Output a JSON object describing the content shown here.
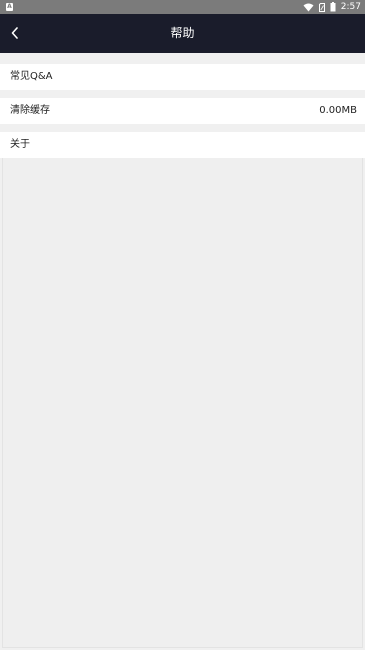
{
  "status_bar": {
    "time": "2:57",
    "left_icon_label": "A",
    "icons": [
      "notification-a-icon",
      "wifi-icon",
      "sim-card-icon",
      "battery-icon"
    ]
  },
  "header": {
    "title": "帮助",
    "back_icon": "chevron-left-icon"
  },
  "menu": {
    "items": [
      {
        "label": "常见Q&A",
        "value": ""
      },
      {
        "label": "清除缓存",
        "value": "0.00MB"
      },
      {
        "label": "关于",
        "value": ""
      }
    ]
  },
  "colors": {
    "status_bar": "#7b7b7b",
    "header_bg": "#1a1c2b",
    "page_bg": "#f0f0f0",
    "item_bg": "#ffffff",
    "text": "#222222"
  }
}
